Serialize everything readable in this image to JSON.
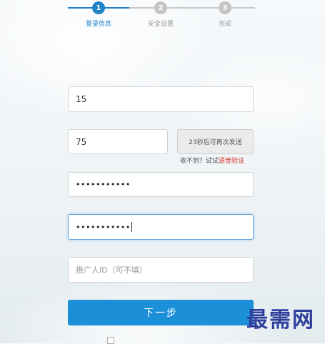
{
  "steps": [
    {
      "number": "1",
      "label": "登录信息"
    },
    {
      "number": "2",
      "label": "安全设置"
    },
    {
      "number": "3",
      "label": "完成"
    }
  ],
  "form": {
    "phone_value": "15",
    "code_value": "75",
    "password_mask": "•••••••••••",
    "confirm_mask": "•••••••••••",
    "referrer_placeholder": "推广人ID（可不填）"
  },
  "sms_button_label": "23秒后可再次发送",
  "voice_hint": {
    "prefix": "收不到？试试",
    "link": "语音验证"
  },
  "next_button_label": "下一步",
  "watermark": "最需网",
  "colors": {
    "accent": "#1d82c6",
    "button": "#1b8fd8",
    "link_red": "#d9322c"
  }
}
